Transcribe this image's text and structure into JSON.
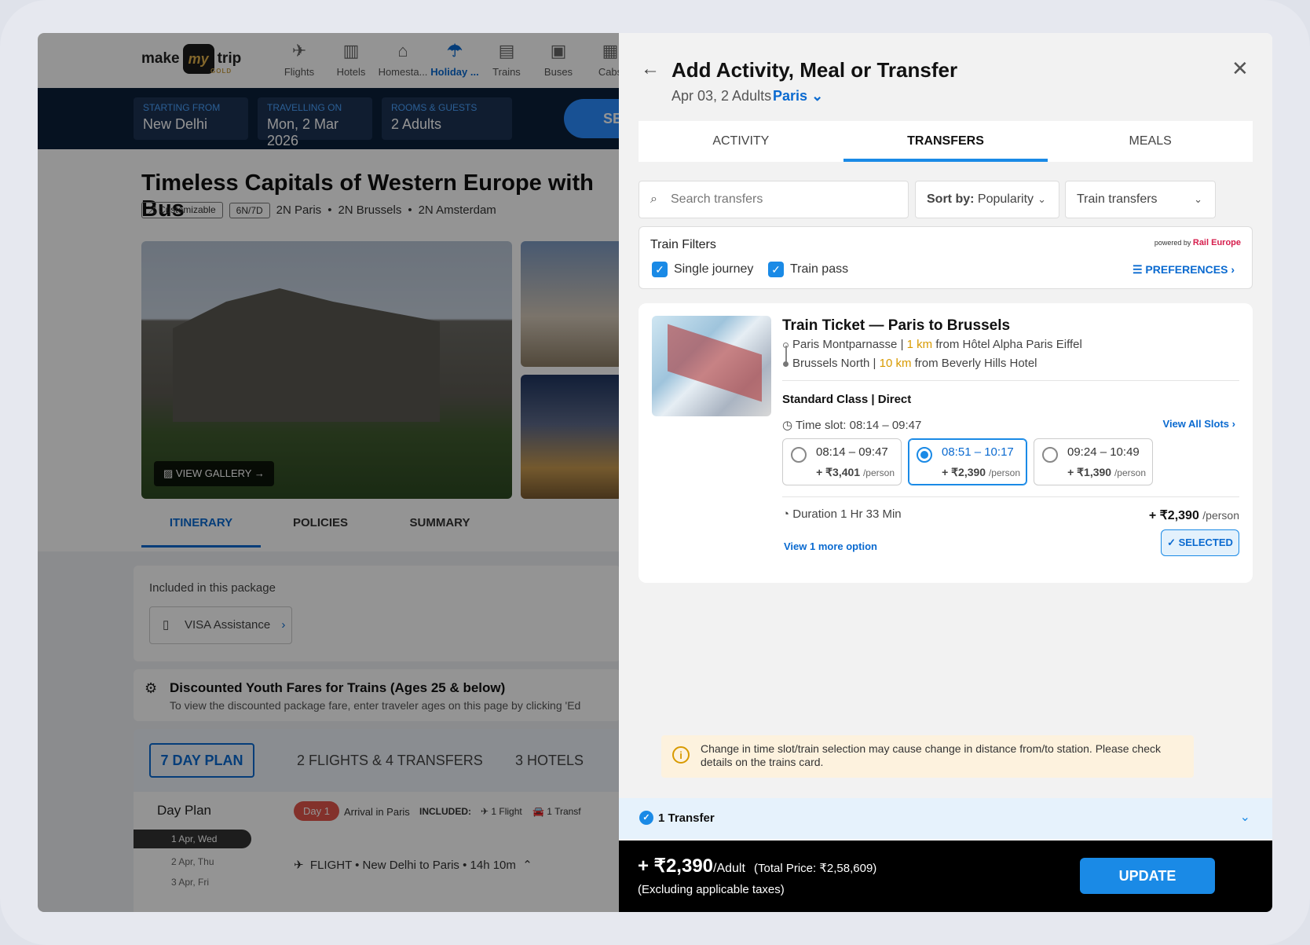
{
  "background_page": {
    "logo": {
      "text_left": "make",
      "text_mark": "my",
      "text_right": "trip",
      "tier": "GOLD"
    },
    "nav": [
      {
        "label": "Flights",
        "icon": "plane-icon",
        "active": false
      },
      {
        "label": "Hotels",
        "icon": "hotel-icon",
        "active": false
      },
      {
        "label": "Homesta...",
        "icon": "homestay-icon",
        "active": false
      },
      {
        "label": "Holiday ...",
        "icon": "holiday-icon",
        "active": true
      },
      {
        "label": "Trains",
        "icon": "train-icon",
        "active": false
      },
      {
        "label": "Buses",
        "icon": "bus-icon",
        "active": false
      },
      {
        "label": "Cabs",
        "icon": "cab-icon",
        "active": false
      }
    ],
    "search": {
      "from_label": "STARTING FROM",
      "from_value": "New Delhi",
      "date_label": "TRAVELLING ON",
      "date_value": "Mon, 2 Mar 2026",
      "guests_label": "ROOMS & GUESTS",
      "guests_value": "2 Adults",
      "button": "SE"
    },
    "package": {
      "title": "Timeless Capitals of Western Europe with Bus",
      "customizable": "Customizable",
      "duration": "6N/7D",
      "stops": [
        "2N Paris",
        "2N Brussels",
        "2N Amsterdam"
      ],
      "view_gallery": "VIEW GALLERY"
    },
    "tabs": [
      "ITINERARY",
      "POLICIES",
      "SUMMARY"
    ],
    "included": {
      "heading": "Included in this package",
      "item": "VISA Assistance"
    },
    "youth": {
      "title": "Discounted Youth Fares for Trains (Ages 25 & below)",
      "subtitle": "To view the discounted package fare, enter traveler ages on this page by clicking 'Ed"
    },
    "plan_tabs": [
      "7 DAY PLAN",
      "2 FLIGHTS & 4 TRANSFERS",
      "3 HOTELS"
    ],
    "day_plan": {
      "heading": "Day Plan",
      "days": [
        "1 Apr, Wed",
        "2 Apr, Thu",
        "3 Apr, Fri"
      ],
      "day_badge": "Day 1",
      "day_title": "Arrival in Paris",
      "included_label": "INCLUDED:",
      "included_flight": "1 Flight",
      "included_transfer": "1 Transf",
      "flight_row": "FLIGHT • New Delhi to Paris • 14h 10m"
    }
  },
  "drawer": {
    "title": "Add Activity, Meal or Transfer",
    "subtitle": "Apr 03, 2 Adults",
    "city": "Paris",
    "tabs": [
      {
        "label": "ACTIVITY",
        "active": false
      },
      {
        "label": "TRANSFERS",
        "active": true
      },
      {
        "label": "MEALS",
        "active": false
      }
    ],
    "search_placeholder": "Search transfers",
    "sort_label": "Sort by:",
    "sort_value": "Popularity",
    "type_select": "Train transfers",
    "filters": {
      "heading": "Train Filters",
      "powered_by": "powered by",
      "partner": "Rail Europe",
      "options": [
        {
          "label": "Single journey",
          "checked": true
        },
        {
          "label": "Train pass",
          "checked": true
        }
      ],
      "preferences": "PREFERENCES"
    },
    "train_card": {
      "title": "Train Ticket — Paris to Brussels",
      "from_station": "Paris Montparnasse |",
      "from_km": "1 km",
      "from_hotel": "from Hôtel Alpha Paris Eiffel",
      "to_station": "Brussels North |",
      "to_km": "10 km",
      "to_hotel": "from Beverly Hills Hotel",
      "class": "Standard Class | Direct",
      "time_slot": "Time slot: 08:14 – 09:47",
      "view_all_slots": "View All Slots",
      "slots": [
        {
          "time": "08:14 – 09:47",
          "price": "+ ₹3,401",
          "unit": "/person",
          "selected": false
        },
        {
          "time": "08:51 – 10:17",
          "price": "+ ₹2,390",
          "unit": "/person",
          "selected": true
        },
        {
          "time": "09:24 – 10:49",
          "price": "+ ₹1,390",
          "unit": "/person",
          "selected": false
        }
      ],
      "duration": "Duration 1 Hr 33 Min",
      "price": "+ ₹2,390",
      "price_unit": "/person",
      "more_option": "View 1 more option",
      "selected_label": "SELECTED"
    },
    "warning": "Change in time slot/train selection may cause change in distance from/to station. Please check details on the trains card.",
    "summary_bar": "1 Transfer",
    "footer": {
      "price": "+ ₹2,390",
      "price_unit": "/Adult",
      "total": "(Total Price: ₹2,58,609)",
      "excluding": "(Excluding applicable taxes)",
      "update": "UPDATE"
    }
  },
  "colors": {
    "accent": "#1a8ae6",
    "link": "#0a6ad0",
    "warning_bg": "#fdf2de",
    "footer_bg": "#000000",
    "distance": "#d89a00"
  }
}
